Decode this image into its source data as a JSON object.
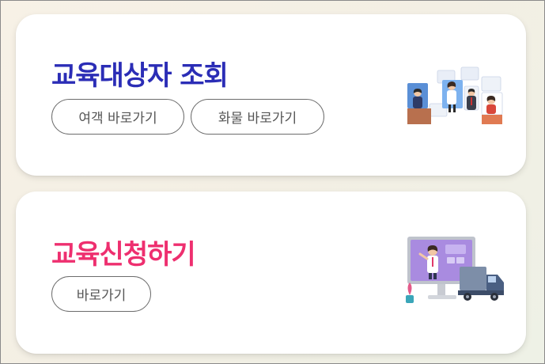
{
  "cards": {
    "lookup": {
      "title": "교육대상자 조회",
      "passenger_button": "여객 바로가기",
      "cargo_button": "화물 바로가기",
      "illustration_icon": "video-conference-people-icon"
    },
    "apply": {
      "title": "교육신청하기",
      "go_button": "바로가기",
      "illustration_icon": "online-lecture-truck-icon"
    }
  },
  "colors": {
    "lookup_title": "#2b2db6",
    "apply_title": "#ee2f6f",
    "card_bg": "#ffffff",
    "page_bg": "#f5f0e6"
  }
}
